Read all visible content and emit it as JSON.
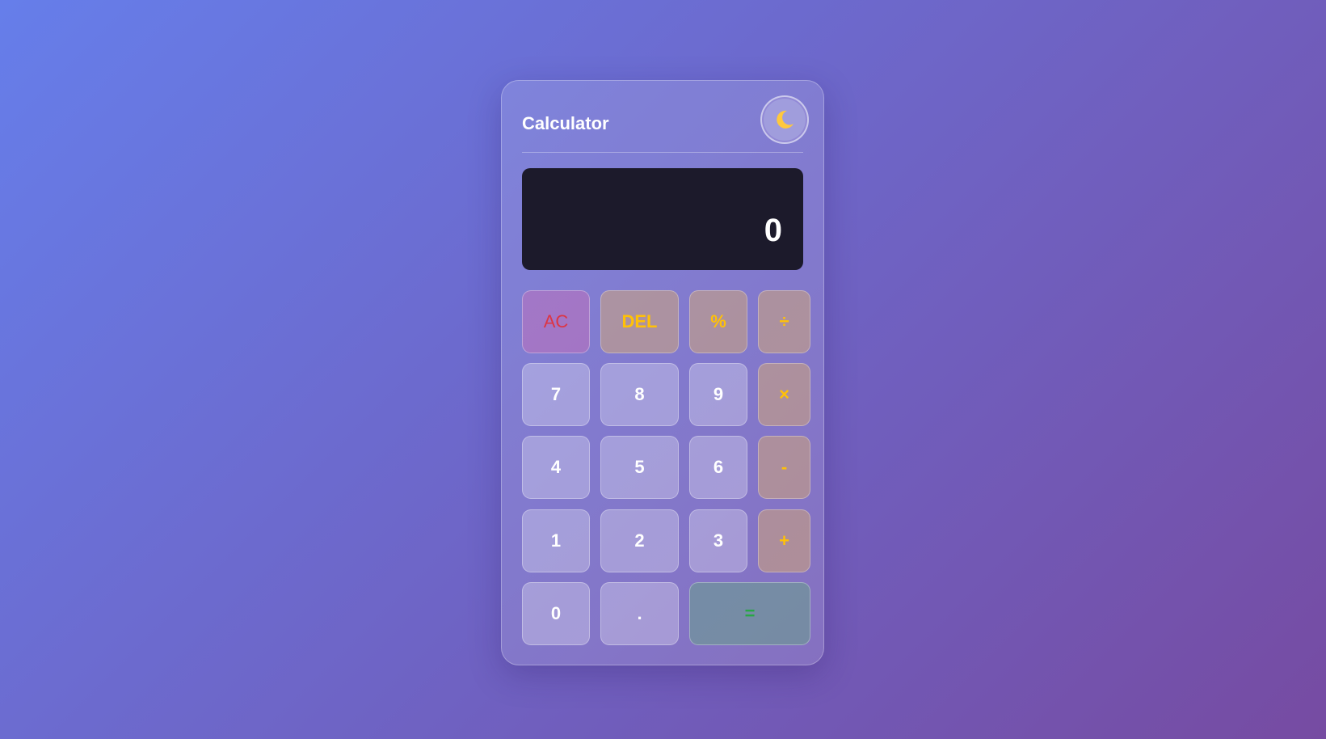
{
  "app": {
    "title": "Calculator",
    "theme_icon": "moon-icon"
  },
  "display": {
    "previous": "",
    "current": "0"
  },
  "colors": {
    "clear_text": "#dc3545",
    "operator_text": "#ffc107",
    "equals_text": "#28a745",
    "number_text": "#ffffff",
    "display_bg": "#1c1a2b",
    "moon": "#ffc83d"
  },
  "buttons": {
    "ac": "AC",
    "del": "DEL",
    "percent": "%",
    "divide": "÷",
    "seven": "7",
    "eight": "8",
    "nine": "9",
    "multiply": "×",
    "four": "4",
    "five": "5",
    "six": "6",
    "minus": "-",
    "one": "1",
    "two": "2",
    "three": "3",
    "plus": "+",
    "zero": "0",
    "decimal": ".",
    "equals": "="
  }
}
